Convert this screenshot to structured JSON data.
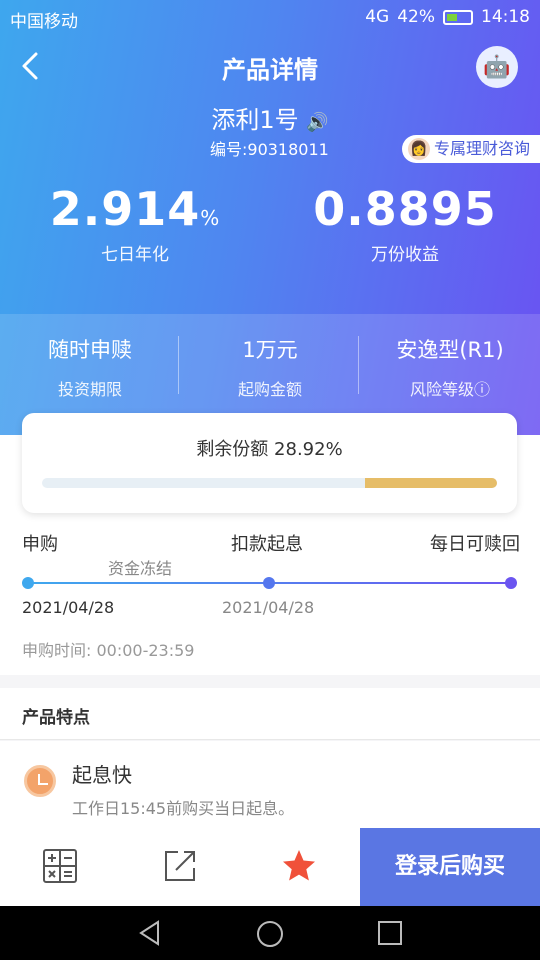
{
  "status": {
    "carrier": "中国移动",
    "network": "4G",
    "battery": "42%",
    "time": "14:18"
  },
  "nav": {
    "title": "产品详情"
  },
  "product": {
    "name": "添利1号",
    "code": "编号:90318011",
    "consult": "专属理财咨询"
  },
  "metrics": [
    {
      "value": "2.914",
      "unit": "%",
      "label": "七日年化"
    },
    {
      "value": "0.8895",
      "unit": "",
      "label": "万份收益"
    }
  ],
  "info": [
    {
      "value": "随时申赎",
      "label": "投资期限"
    },
    {
      "value": "1万元",
      "label": "起购金额"
    },
    {
      "value": "安逸型(R1)",
      "label": "风险等级ⓘ"
    }
  ],
  "remain": {
    "text": "剩余份额 28.92%",
    "fraction": 0.2892
  },
  "steps": {
    "s1": "申购",
    "s2": "扣款起息",
    "s3": "每日可赎回",
    "freeze": "资金冻结",
    "date1": "2021/04/28",
    "date2": "2021/04/28",
    "time": "申购时间: 00:00-23:59"
  },
  "features": {
    "title": "产品特点",
    "items": [
      {
        "name": "起息快",
        "desc": "工作日15:45前购买当日起息。"
      }
    ]
  },
  "bottom": {
    "buy_label": "登录后购买"
  },
  "colors": {
    "accent": "#5a76e3",
    "gold": "#e6bd68",
    "star": "#f0513a"
  },
  "icons": [
    "back-icon",
    "robot-icon",
    "speaker-icon",
    "calculator-icon",
    "share-icon",
    "star-icon"
  ]
}
